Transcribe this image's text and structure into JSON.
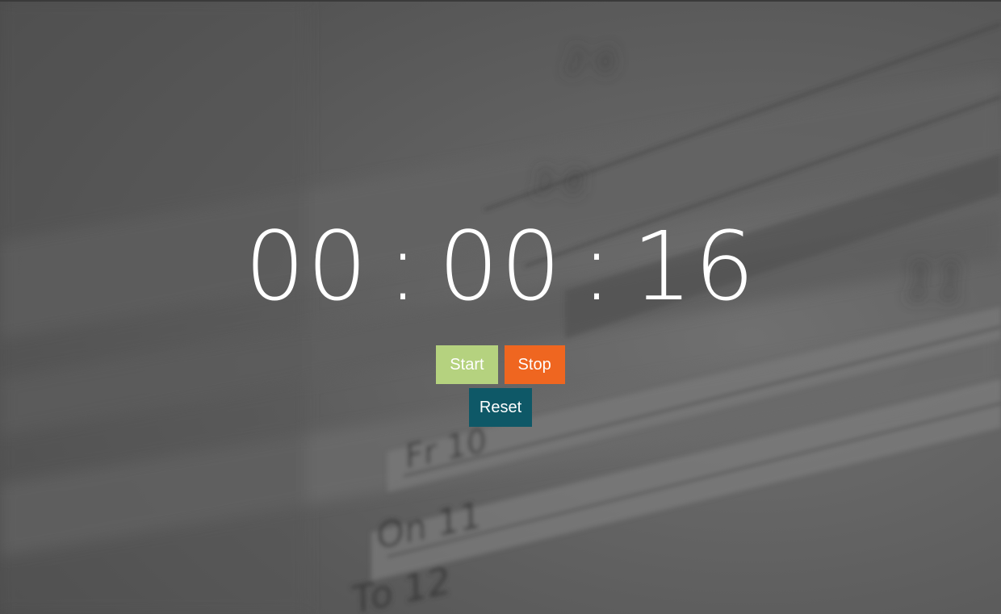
{
  "timer": {
    "hours": "00",
    "separator_1": ":",
    "minutes": "00",
    "separator_2": ":",
    "seconds": "16"
  },
  "controls": {
    "start_label": "Start",
    "stop_label": "Stop",
    "reset_label": "Reset"
  },
  "colors": {
    "start": "#b5d27f",
    "stop": "#ef6620",
    "reset": "#0e5867",
    "overlay": "#5a5a5a",
    "text": "#ffffff"
  },
  "background": {
    "description_icon": "calendar-photo"
  }
}
